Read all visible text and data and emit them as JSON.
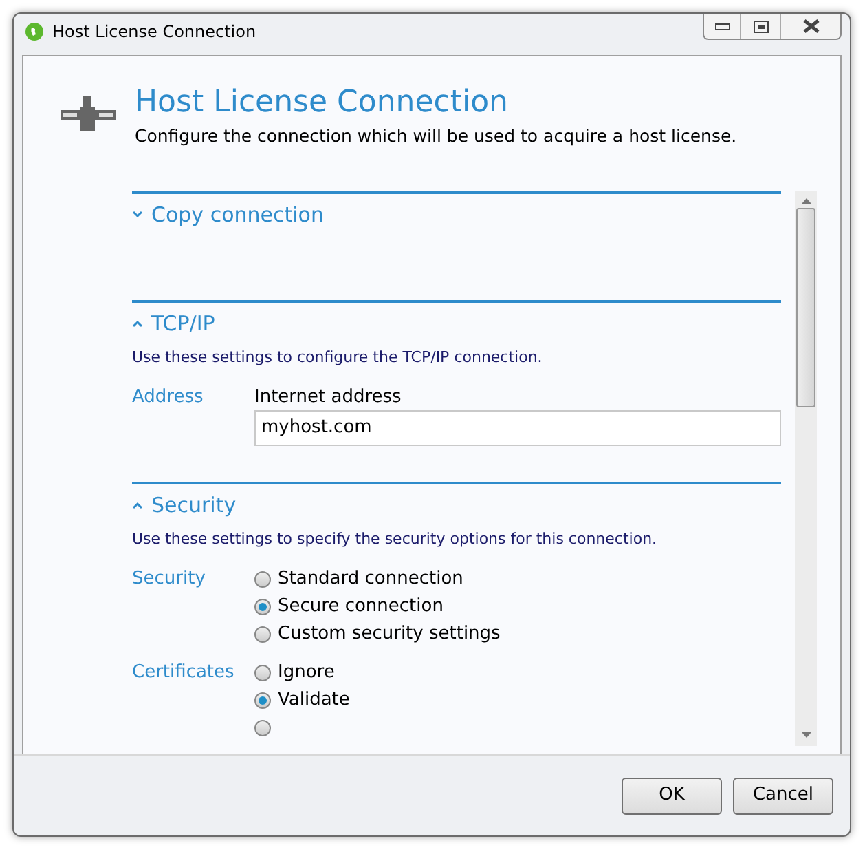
{
  "window": {
    "title": "Host License Connection"
  },
  "header": {
    "title": "Host License Connection",
    "subtitle": "Configure the connection which will be used to acquire a host license."
  },
  "sections": [
    {
      "title": "Copy connection",
      "expanded": false
    },
    {
      "title": "TCP/IP",
      "expanded": true,
      "description": "Use these settings to configure the TCP/IP connection.",
      "groups": [
        {
          "label": "Address",
          "kind": "field",
          "field_label": "Internet address",
          "value": "myhost.com"
        }
      ]
    },
    {
      "title": "Security",
      "expanded": true,
      "description": "Use these settings to specify the security options for this connection.",
      "groups": [
        {
          "label": "Security",
          "kind": "radios",
          "options": [
            {
              "label": "Standard connection",
              "selected": false
            },
            {
              "label": "Secure connection",
              "selected": true
            },
            {
              "label": "Custom security settings",
              "selected": false
            }
          ]
        },
        {
          "label": "Certificates",
          "kind": "radios",
          "options": [
            {
              "label": "Ignore",
              "selected": false
            },
            {
              "label": "Validate",
              "selected": true
            },
            {
              "selected": false
            }
          ]
        }
      ]
    }
  ],
  "buttons": [
    "OK",
    "Cancel"
  ]
}
